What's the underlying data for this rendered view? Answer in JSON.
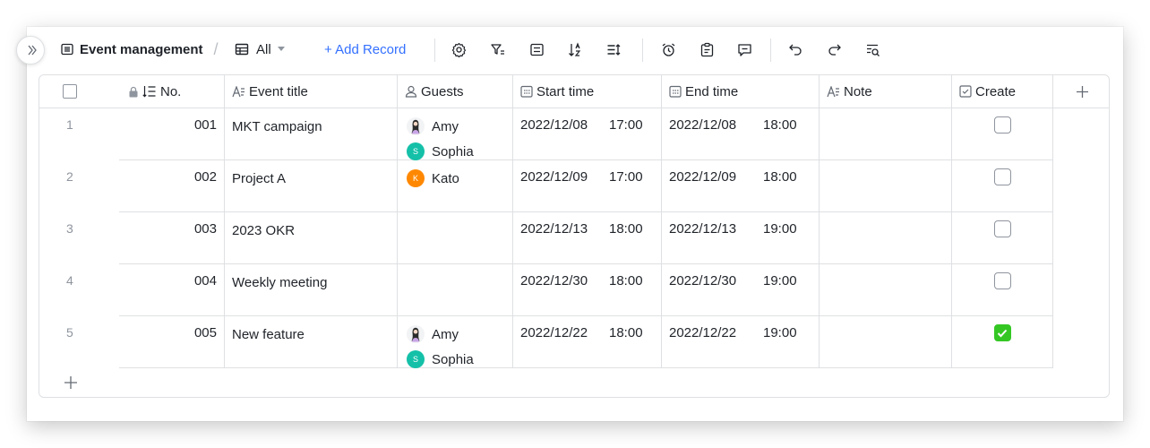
{
  "toolbar": {
    "breadcrumb_title": "Event management",
    "breadcrumb_separator": "/",
    "view_label": "All",
    "add_record_label": "+ Add Record"
  },
  "columns": {
    "no": "No.",
    "event_title": "Event title",
    "guests": "Guests",
    "start_time": "Start time",
    "end_time": "End time",
    "note": "Note",
    "create": "Create"
  },
  "rows": [
    {
      "index": "1",
      "no": "001",
      "title": "MKT campaign",
      "guests": [
        {
          "name": "Amy",
          "initial": "",
          "color": "#f2f3f5"
        },
        {
          "name": "Sophia",
          "initial": "S",
          "color": "#14c0a8"
        }
      ],
      "start_date": "2022/12/08",
      "start_time": "17:00",
      "end_date": "2022/12/08",
      "end_time": "18:00",
      "note": "",
      "create": false
    },
    {
      "index": "2",
      "no": "002",
      "title": "Project A",
      "guests": [
        {
          "name": "Kato",
          "initial": "K",
          "color": "#ff8800"
        }
      ],
      "start_date": "2022/12/09",
      "start_time": "17:00",
      "end_date": "2022/12/09",
      "end_time": "18:00",
      "note": "",
      "create": false
    },
    {
      "index": "3",
      "no": "003",
      "title": "2023 OKR",
      "guests": [],
      "start_date": "2022/12/13",
      "start_time": "18:00",
      "end_date": "2022/12/13",
      "end_time": "19:00",
      "note": "",
      "create": false
    },
    {
      "index": "4",
      "no": "004",
      "title": "Weekly meeting",
      "guests": [],
      "start_date": "2022/12/30",
      "start_time": "18:00",
      "end_date": "2022/12/30",
      "end_time": "19:00",
      "note": "",
      "create": false
    },
    {
      "index": "5",
      "no": "005",
      "title": "New feature",
      "guests": [
        {
          "name": "Amy",
          "initial": "",
          "color": "#f2f3f5"
        },
        {
          "name": "Sophia",
          "initial": "S",
          "color": "#14c0a8"
        }
      ],
      "start_date": "2022/12/22",
      "start_time": "18:00",
      "end_date": "2022/12/22",
      "end_time": "19:00",
      "note": "",
      "create": true
    }
  ],
  "colors": {
    "accent": "#3370ff",
    "checkbox_checked": "#34c724",
    "border": "#dee0e3"
  }
}
